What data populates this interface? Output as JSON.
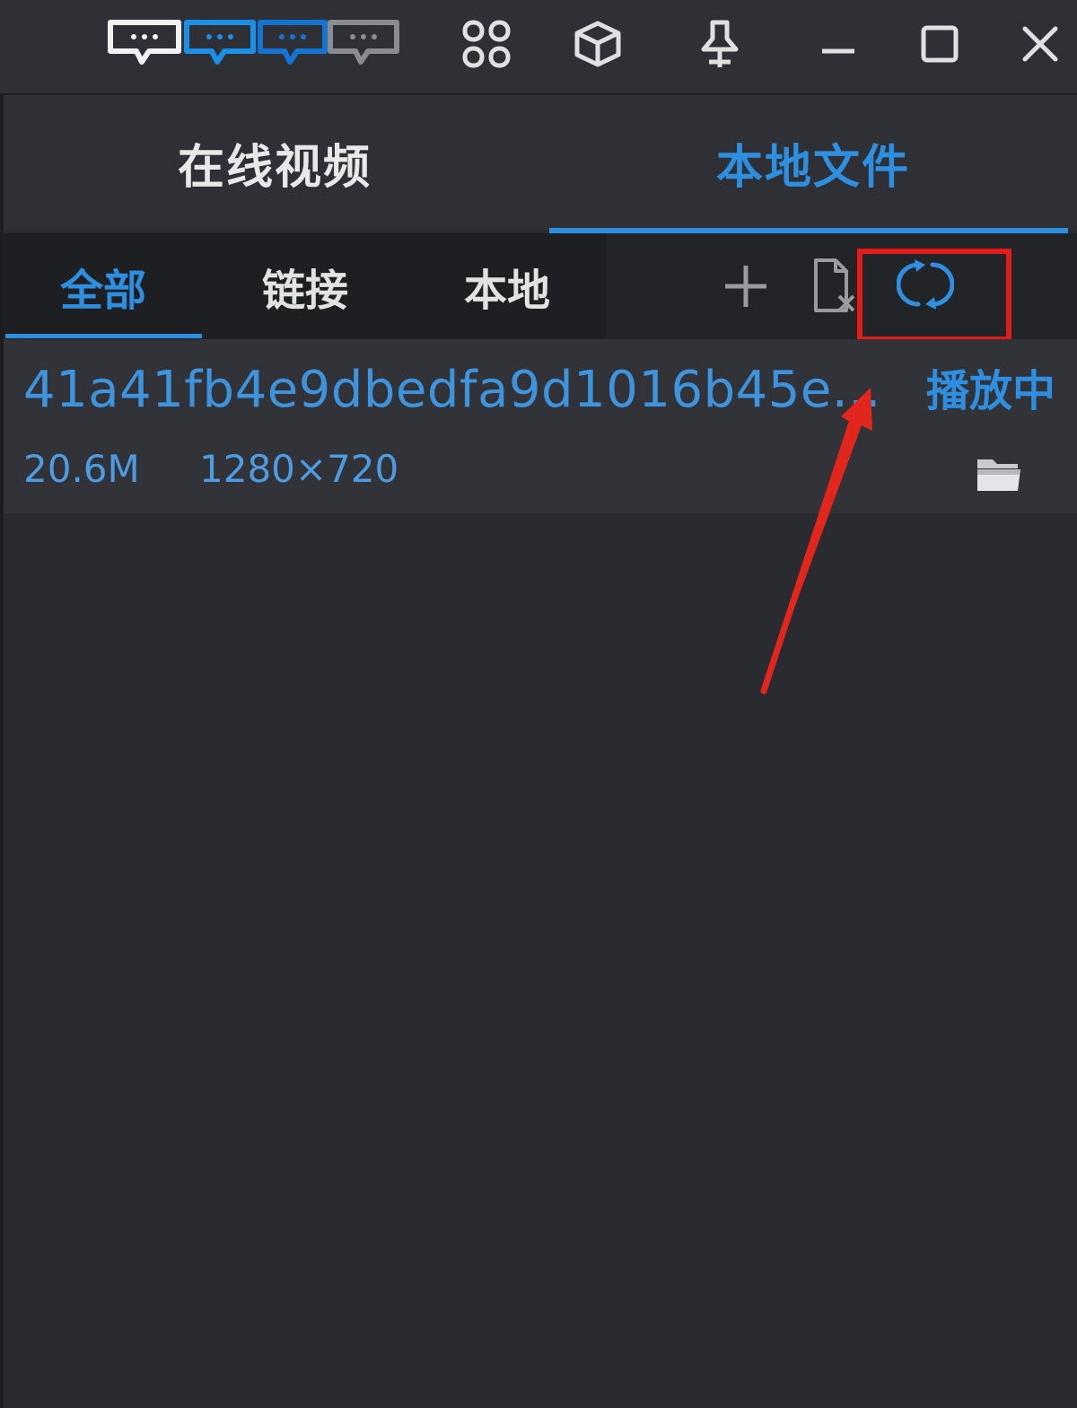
{
  "titlebar": {
    "icons": [
      "danmaku-white-icon",
      "danmaku-blue-icon",
      "danmaku-blue-dark-icon",
      "danmaku-gray-icon",
      "apps-icon",
      "cube-icon",
      "pin-icon",
      "minimize-icon",
      "maximize-icon",
      "close-icon"
    ]
  },
  "main_tabs": {
    "online": "在线视频",
    "local": "本地文件",
    "active": "local"
  },
  "sub_tabs": {
    "all": "全部",
    "link": "链接",
    "local": "本地",
    "active": "all"
  },
  "toolbar": {
    "icons": [
      "add-icon",
      "delete-file-icon",
      "refresh-icon"
    ],
    "highlighted": "refresh-icon"
  },
  "file": {
    "name": "41a41fb4e9dbedfa9d1016b45e...",
    "status": "播放中",
    "size": "20.6M",
    "resolution": "1280×720"
  },
  "colors": {
    "accent": "#2e8fe0",
    "background": "#2a2b30",
    "annotation": "#e31b1b"
  }
}
